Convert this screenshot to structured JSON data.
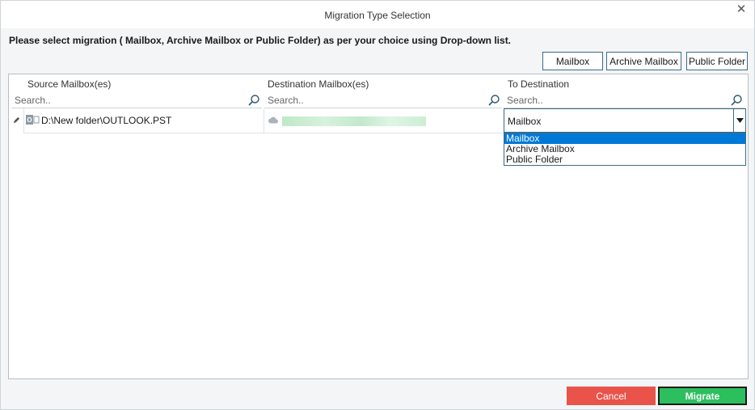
{
  "window": {
    "title": "Migration Type Selection"
  },
  "instruction": "Please select migration ( Mailbox, Archive Mailbox or Public Folder) as per your choice using Drop-down list.",
  "type_buttons": {
    "mailbox": "Mailbox",
    "archive": "Archive Mailbox",
    "public_folder": "Public Folder"
  },
  "grid": {
    "columns": {
      "source": "Source Mailbox(es)",
      "destination": "Destination Mailbox(es)",
      "to_destination": "To Destination"
    },
    "search_placeholder": "Search..",
    "rows": [
      {
        "source": "D:\\New folder\\OUTLOOK.PST",
        "destination": "",
        "to_destination": "Mailbox"
      }
    ]
  },
  "dropdown_options": [
    "Mailbox",
    "Archive Mailbox",
    "Public Folder"
  ],
  "footer": {
    "cancel": "Cancel",
    "migrate": "Migrate"
  },
  "colors": {
    "accent": "#0078d7",
    "cancel": "#e9534a",
    "migrate": "#2bbf5e",
    "border": "#3d6b86"
  },
  "icons": {
    "close": "close-icon",
    "search": "search-icon",
    "edit": "pencil-icon",
    "pst": "outlook-pst-icon",
    "cloud": "cloud-icon",
    "dropdown": "chevron-down-icon"
  }
}
